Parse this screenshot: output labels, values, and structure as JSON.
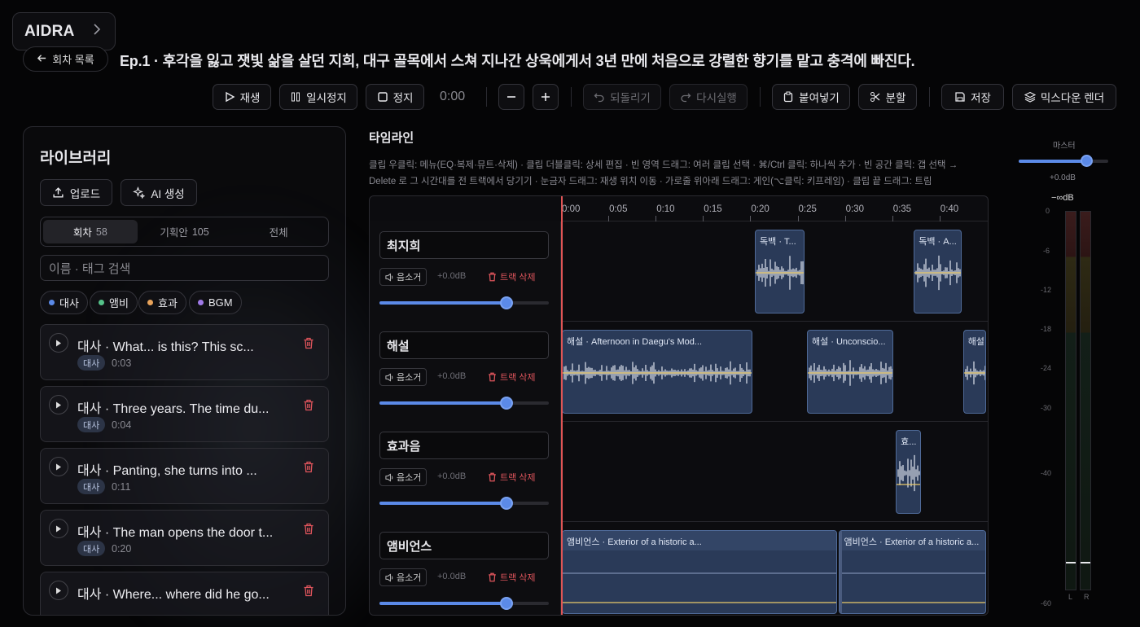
{
  "app": {
    "brand": "AIDRA"
  },
  "header": {
    "back_label": "회차 목록",
    "episode_title": "Ep.1 · 후각을 잃고 잿빛 삶을 살던 지희, 대구 골목에서 스쳐 지나간 상욱에게서 3년 만에 처음으로 강렬한 향기를 맡고 충격에 빠진다."
  },
  "toolbar": {
    "play": "재생",
    "pause": "일시정지",
    "stop": "정지",
    "time": "0:00",
    "undo": "되돌리기",
    "redo": "다시실행",
    "paste": "붙여넣기",
    "split": "분할",
    "save": "저장",
    "mixdown": "믹스다운 렌더"
  },
  "library": {
    "title": "라이브러리",
    "upload": "업로드",
    "ai_generate": "AI 생성",
    "tabs": [
      {
        "label": "회차",
        "count": "58"
      },
      {
        "label": "기획안",
        "count": "105"
      },
      {
        "label": "전체",
        "count": ""
      }
    ],
    "search_placeholder": "이름 · 태그 검색",
    "filters": [
      {
        "label": "대사",
        "color": "#5b8ae8"
      },
      {
        "label": "앰비",
        "color": "#55c28a"
      },
      {
        "label": "효과",
        "color": "#e8a35b"
      },
      {
        "label": "BGM",
        "color": "#a07ae8"
      }
    ],
    "items": [
      {
        "name": "대사 · What... is this? This sc...",
        "tag": "대사",
        "duration": "0:03"
      },
      {
        "name": "대사 · Three years. The time du...",
        "tag": "대사",
        "duration": "0:04"
      },
      {
        "name": "대사 · Panting, she turns into ...",
        "tag": "대사",
        "duration": "0:11"
      },
      {
        "name": "대사 · The man opens the door t...",
        "tag": "대사",
        "duration": "0:20"
      },
      {
        "name": "대사 · Where... where did he go...",
        "tag": "대사",
        "duration": ""
      }
    ]
  },
  "timeline": {
    "title": "타임라인",
    "hint": "클립 우클릭: 메뉴(EQ·복제·뮤트·삭제) · 클립 더블클릭: 상세 편집 · 빈 영역 드래그: 여러 클립 선택 · ⌘/Ctrl 클릭: 하나씩 추가 · 빈 공간 클릭: 갭 선택 → Delete 로 그 시간대를 전 트랙에서 당기기 · 눈금자 드래그: 재생 위치 이동 · 가로줄 위아래 드래그: 게인(⌥클릭: 키프레임) · 클립 끝 드래그: 트림",
    "ruler": [
      "0:00",
      "0:05",
      "0:10",
      "0:15",
      "0:20",
      "0:25",
      "0:30",
      "0:35",
      "0:40"
    ],
    "mute_label": "음소거",
    "delete_label": "트랙 삭제",
    "tracks": [
      {
        "name": "최지희",
        "gain": "+0.0dB",
        "volume": 0.75,
        "clips": [
          {
            "label": "독백 · T...",
            "start": 20.4,
            "end": 25.8
          },
          {
            "label": "독백 · A...",
            "start": 37.2,
            "end": 42.4
          }
        ]
      },
      {
        "name": "해설",
        "gain": "+0.0dB",
        "volume": 0.75,
        "clips": [
          {
            "label": "해설 · Afternoon in Daegu's Mod...",
            "start": 0,
            "end": 20.3
          },
          {
            "label": "해설 · Unconscio...",
            "start": 25.9,
            "end": 35.2
          },
          {
            "label": "해설",
            "start": 42.4,
            "end": 45
          }
        ]
      },
      {
        "name": "효과음",
        "gain": "+0.0dB",
        "volume": 0.75,
        "clips": [
          {
            "label": "효...",
            "start": 35.3,
            "end": 38.1
          }
        ]
      },
      {
        "name": "앰비언스",
        "gain": "+0.0dB",
        "volume": 0.75,
        "clips": [
          {
            "label": "앰비언스 · Exterior of a historic a...",
            "start": 0,
            "end": 29.3
          },
          {
            "label": "앰비언스 · Exterior of a historic a...",
            "start": 29.3,
            "end": 45
          }
        ]
      }
    ]
  },
  "master": {
    "label": "마스터",
    "gain": "+0.0dB",
    "peak": "−∞dB",
    "level": 0.75,
    "scale": [
      "0",
      "-6",
      "-12",
      "-18",
      "-24",
      "-30",
      "-40",
      "-60"
    ],
    "left": "L",
    "right": "R"
  }
}
